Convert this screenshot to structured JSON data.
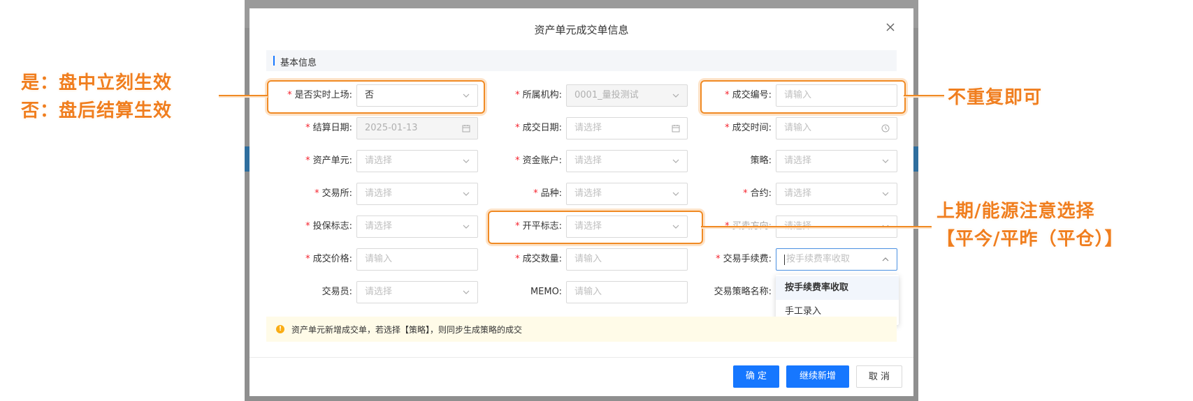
{
  "modal": {
    "title": "资产单元成交单信息",
    "section": "基本信息"
  },
  "fields": {
    "is_live": {
      "label": "是否实时上场:",
      "value": "否"
    },
    "org": {
      "label": "所属机构:",
      "value": "0001_量投测试"
    },
    "trade_no": {
      "label": "成交编号:",
      "placeholder": "请输入"
    },
    "settle_date": {
      "label": "结算日期:",
      "value": "2025-01-13"
    },
    "trade_date": {
      "label": "成交日期:",
      "placeholder": "请选择"
    },
    "trade_time": {
      "label": "成交时间:",
      "placeholder": "请输入"
    },
    "asset_unit": {
      "label": "资产单元:",
      "placeholder": "请选择"
    },
    "fund_account": {
      "label": "资金账户:",
      "placeholder": "请选择"
    },
    "strategy": {
      "label": "策略:",
      "placeholder": "请选择"
    },
    "exchange": {
      "label": "交易所:",
      "placeholder": "请选择"
    },
    "variety": {
      "label": "品种:",
      "placeholder": "请选择"
    },
    "contract": {
      "label": "合约:",
      "placeholder": "请选择"
    },
    "hedge_flag": {
      "label": "投保标志:",
      "placeholder": "请选择"
    },
    "offset_flag": {
      "label": "开平标志:",
      "placeholder": "请选择"
    },
    "direction": {
      "label": "买卖方向:",
      "placeholder": "请选择"
    },
    "price": {
      "label": "成交价格:",
      "placeholder": "请输入"
    },
    "quantity": {
      "label": "成交数量:",
      "placeholder": "请输入"
    },
    "fee": {
      "label": "交易手续费:",
      "placeholder": "按手续费率收取"
    },
    "trader": {
      "label": "交易员:",
      "placeholder": "请选择"
    },
    "memo": {
      "label": "MEMO:",
      "placeholder": "请输入"
    },
    "strategy_name": {
      "label": "交易策略名称:"
    }
  },
  "dropdown": {
    "options": [
      "按手续费率收取",
      "手工录入"
    ]
  },
  "tip": "资产单元新增成交单，若选择【策略】，则同步生成策略的成交",
  "buttons": {
    "ok": "确 定",
    "continue": "继续新增",
    "cancel": "取 消"
  },
  "annotations": {
    "left_line1": "是：盘中立刻生效",
    "left_line2": "否：盘后结算生效",
    "right_top": "不重复即可",
    "right_mid_line1": "上期/能源注意选择",
    "right_mid_line2": "【平今/平昨（平仓）】"
  },
  "colors": {
    "primary": "#1677ff",
    "annotation": "#f08a24",
    "required": "#f5222d"
  }
}
